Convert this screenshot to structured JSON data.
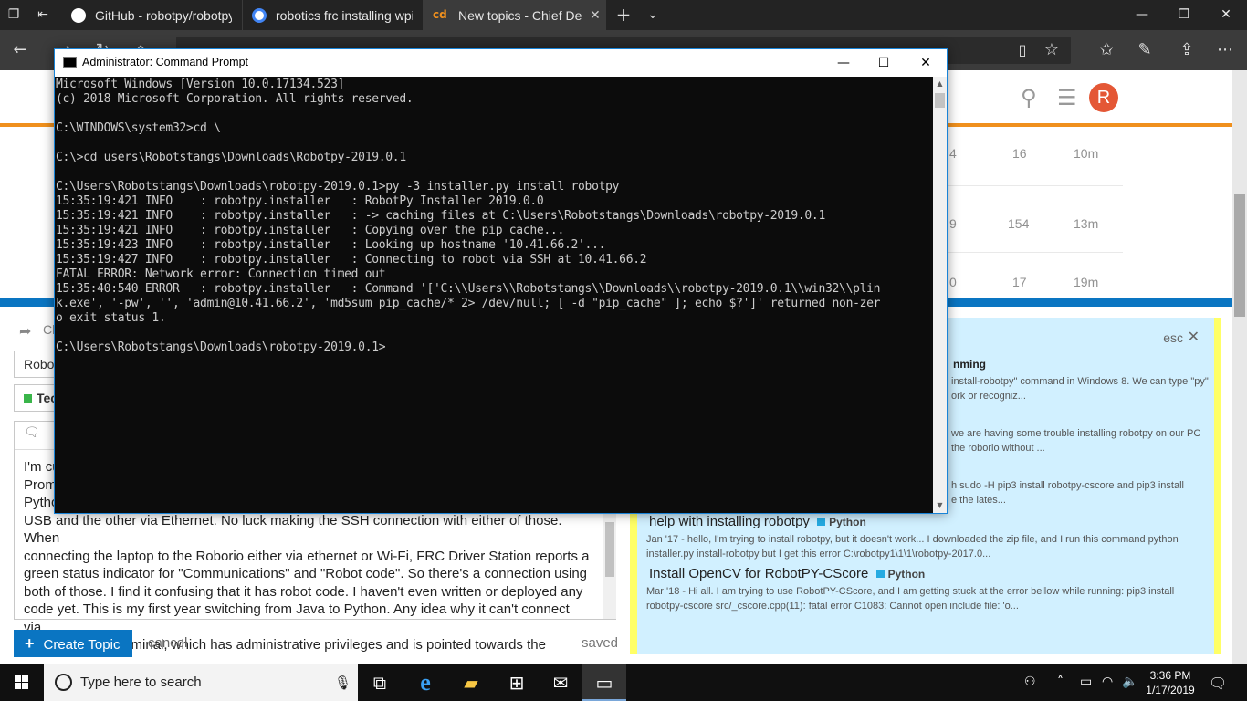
{
  "browser": {
    "tabs": [
      {
        "title": "GitHub - robotpy/robotpy-w",
        "favicon_color": "#ffffff"
      },
      {
        "title": "robotics frc installing wpilib",
        "favicon_color": "#4285f4"
      },
      {
        "title": "New topics - Chief Delphi",
        "favicon_color": "#f0901d",
        "favicon_text": "cd",
        "active": true
      }
    ],
    "new_tab": "+",
    "tab_dropdown": "⌄"
  },
  "forum": {
    "avatar_letter": "R",
    "rows": [
      {
        "replies": "4",
        "views": "16",
        "activity": "10m"
      },
      {
        "replies": "9",
        "views": "154",
        "activity": "13m"
      },
      {
        "replies": "0",
        "views": "17",
        "activity": "19m"
      }
    ],
    "composer": {
      "title_value": "Robo",
      "category_value": "Tec",
      "partial_label": "Ch",
      "body_lines": [
        "I'm cu",
        "Prom",
        "Pytho",
        "USB and the other via Ethernet. No luck making the SSH connection with either of those. When",
        "connecting the laptop to the Roborio either via ethernet or Wi-Fi, FRC Driver Station reports a",
        "green status indicator for \"Communications\" and \"Robot code\". So there's a connection using",
        "both of those. I find it confusing that it has robot code. I haven't even written or deployed any",
        "code yet. This is my first year switching from Java to Python. Any idea why it can't connect via",
        "SSH using the terminal, which has administrative privileges and is pointed towards the"
      ],
      "create_label": "Create Topic",
      "cancel_label": "cancel",
      "saved_label": "saved"
    },
    "similar": {
      "esc_label": "esc",
      "partials": [
        {
          "title": "nming",
          "excerpt": "install-robotpy\" command in Windows 8. We can type \"py\"",
          "excerpt2": "ork or recogniz..."
        },
        {
          "excerpt": "we are having some trouble installing robotpy on our PC",
          "excerpt2": "the roborio without ..."
        },
        {
          "excerpt": "h sudo -H pip3 install robotpy-cscore and pip3 install",
          "excerpt2": "e the lates..."
        }
      ],
      "topics": [
        {
          "title": "help with installing robotpy",
          "category": "Python",
          "excerpt1": "Jan '17 - hello, I'm trying to install robotpy, but it doesn't work... I downloaded the zip file, and I run this command python",
          "excerpt2": "installer.py install-robotpy but I get this error C:\\robotpy1\\1\\1\\robotpy-2017.0..."
        },
        {
          "title": "Install OpenCV for RobotPY-CScore",
          "category": "Python",
          "excerpt1": "Mar '18 - Hi all. I am trying to use RobotPY-CScore, and I am getting stuck at the error bellow while running: pip3 install",
          "excerpt2": "robotpy-cscore src/_cscore.cpp(11): fatal error C1083: Cannot open include file: 'o..."
        }
      ]
    }
  },
  "cmd": {
    "title": "Administrator: Command Prompt",
    "lines": [
      "Microsoft Windows [Version 10.0.17134.523]",
      "(c) 2018 Microsoft Corporation. All rights reserved.",
      "",
      "C:\\WINDOWS\\system32>cd \\",
      "",
      "C:\\>cd users\\Robotstangs\\Downloads\\Robotpy-2019.0.1",
      "",
      "C:\\Users\\Robotstangs\\Downloads\\robotpy-2019.0.1>py -3 installer.py install robotpy",
      "15:35:19:421 INFO    : robotpy.installer   : RobotPy Installer 2019.0.0",
      "15:35:19:421 INFO    : robotpy.installer   : -> caching files at C:\\Users\\Robotstangs\\Downloads\\robotpy-2019.0.1",
      "15:35:19:421 INFO    : robotpy.installer   : Copying over the pip cache...",
      "15:35:19:423 INFO    : robotpy.installer   : Looking up hostname '10.41.66.2'...",
      "15:35:19:427 INFO    : robotpy.installer   : Connecting to robot via SSH at 10.41.66.2",
      "FATAL ERROR: Network error: Connection timed out",
      "15:35:40:540 ERROR   : robotpy.installer   : Command '['C:\\\\Users\\\\Robotstangs\\\\Downloads\\\\robotpy-2019.0.1\\\\win32\\\\plin",
      "k.exe', '-pw', '', 'admin@10.41.66.2', 'md5sum pip_cache/* 2> /dev/null; [ -d \"pip_cache\" ]; echo $?']' returned non-zer",
      "o exit status 1.",
      "",
      "C:\\Users\\Robotstangs\\Downloads\\robotpy-2019.0.1>"
    ]
  },
  "taskbar": {
    "search_placeholder": "Type here to search",
    "time": "3:36 PM",
    "date": "1/17/2019"
  }
}
